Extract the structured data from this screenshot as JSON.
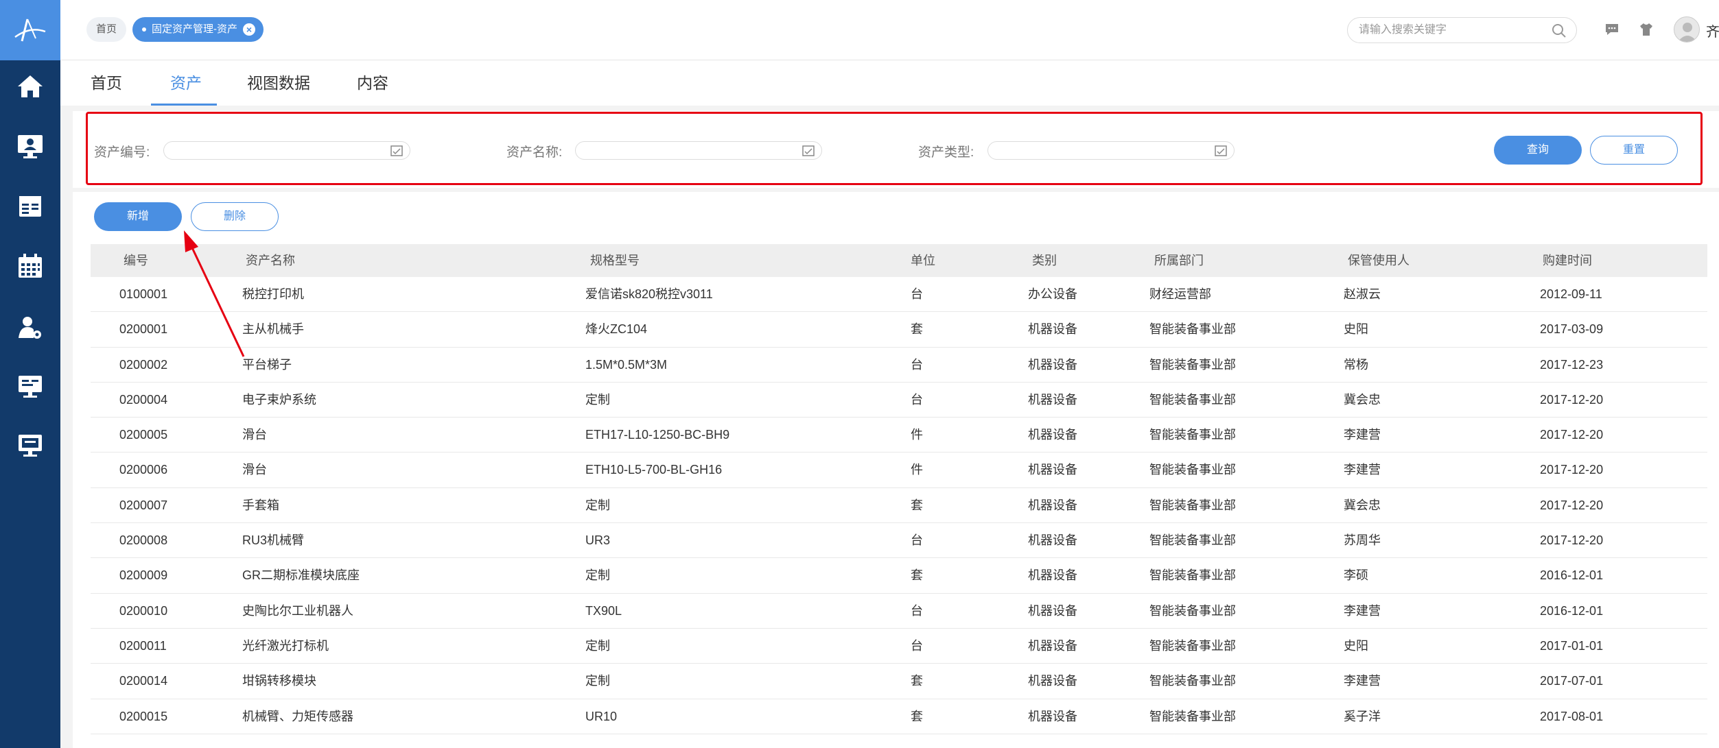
{
  "header": {
    "tags": {
      "home": "首页",
      "active": "固定资产管理-资产"
    },
    "search": {
      "placeholder": "请输入搜索关键字"
    },
    "user_name": "齐"
  },
  "tabs": [
    {
      "label": "首页",
      "active": false
    },
    {
      "label": "资产",
      "active": true
    },
    {
      "label": "视图数据",
      "active": false
    },
    {
      "label": "内容",
      "active": false
    }
  ],
  "filter": {
    "asset_no_label": "资产编号:",
    "asset_name_label": "资产名称:",
    "asset_type_label": "资产类型:",
    "query_label": "查询",
    "reset_label": "重置"
  },
  "toolbar": {
    "add_label": "新增",
    "delete_label": "删除"
  },
  "table": {
    "headers": [
      "编号",
      "资产名称",
      "规格型号",
      "单位",
      "类别",
      "所属部门",
      "保管使用人",
      "购建时间"
    ],
    "rows": [
      [
        "0100001",
        "税控打印机",
        "爱信诺sk820税控v3011",
        "台",
        "办公设备",
        "财经运营部",
        "赵淑云",
        "2012-09-11"
      ],
      [
        "0200001",
        "主从机械手",
        "烽火ZC104",
        "套",
        "机器设备",
        "智能装备事业部",
        "史阳",
        "2017-03-09"
      ],
      [
        "0200002",
        "平台梯子",
        "1.5M*0.5M*3M",
        "台",
        "机器设备",
        "智能装备事业部",
        "常杨",
        "2017-12-23"
      ],
      [
        "0200004",
        "电子束炉系统",
        "定制",
        "台",
        "机器设备",
        "智能装备事业部",
        "冀会忠",
        "2017-12-20"
      ],
      [
        "0200005",
        "滑台",
        "ETH17-L10-1250-BC-BH9",
        "件",
        "机器设备",
        "智能装备事业部",
        "李建营",
        "2017-12-20"
      ],
      [
        "0200006",
        "滑台",
        "ETH10-L5-700-BL-GH16",
        "件",
        "机器设备",
        "智能装备事业部",
        "李建营",
        "2017-12-20"
      ],
      [
        "0200007",
        "手套箱",
        "定制",
        "套",
        "机器设备",
        "智能装备事业部",
        "冀会忠",
        "2017-12-20"
      ],
      [
        "0200008",
        "RU3机械臂",
        "UR3",
        "台",
        "机器设备",
        "智能装备事业部",
        "苏周华",
        "2017-12-20"
      ],
      [
        "0200009",
        "GR二期标准模块底座",
        "定制",
        "套",
        "机器设备",
        "智能装备事业部",
        "李硕",
        "2016-12-01"
      ],
      [
        "0200010",
        "史陶比尔工业机器人",
        "TX90L",
        "台",
        "机器设备",
        "智能装备事业部",
        "李建营",
        "2016-12-01"
      ],
      [
        "0200011",
        "光纤激光打标机",
        "定制",
        "台",
        "机器设备",
        "智能装备事业部",
        "史阳",
        "2017-01-01"
      ],
      [
        "0200014",
        "坩锅转移模块",
        "定制",
        "套",
        "机器设备",
        "智能装备事业部",
        "李建营",
        "2017-07-01"
      ],
      [
        "0200015",
        "机械臂、力矩传感器",
        "UR10",
        "套",
        "机器设备",
        "智能装备事业部",
        "奚子洋",
        "2017-08-01"
      ]
    ]
  },
  "colors": {
    "sidebar": "#123a6a",
    "accent": "#4a8fe2",
    "highlight": "#e60012"
  },
  "icons": {
    "sidebar": [
      "home-icon",
      "monitor-user-icon",
      "calendar-list-icon",
      "calendar-icon",
      "user-settings-icon",
      "presentation-icon",
      "display-icon"
    ],
    "header": [
      "search-icon",
      "message-icon",
      "shirt-icon",
      "avatar"
    ]
  }
}
